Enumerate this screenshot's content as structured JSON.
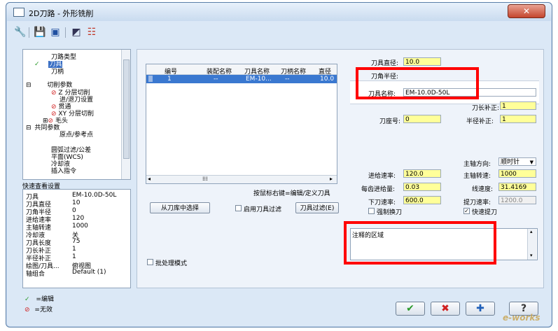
{
  "window": {
    "title": "2D刀路 - 外形铣削"
  },
  "toolbar": {
    "icons": [
      "tool-icon",
      "save-icon",
      "save-all-icon",
      "view-icon",
      "options-icon"
    ]
  },
  "tree": {
    "items": [
      "刀路类型",
      "刀具",
      "刀柄",
      "切削参数",
      "Z 分层切削",
      "进/退刀设置",
      "贯通",
      "XY 分层切削",
      "毛头",
      "共同参数",
      "原点/参考点",
      "圆弧过滤/公差",
      "平面(WCS)",
      "冷却液",
      "插入指令"
    ]
  },
  "quick_view": {
    "title": "快速查看设置",
    "rows": [
      {
        "k": "刀具",
        "v": "EM-10.0D-50L"
      },
      {
        "k": "刀具直径",
        "v": "10"
      },
      {
        "k": "刀角半径",
        "v": "0"
      },
      {
        "k": "进给速率",
        "v": "120"
      },
      {
        "k": "主轴转速",
        "v": "1000"
      },
      {
        "k": "冷却液",
        "v": "关"
      },
      {
        "k": "刀具长度",
        "v": "75"
      },
      {
        "k": "刀长补正",
        "v": "1"
      },
      {
        "k": "半径补正",
        "v": "1"
      },
      {
        "k": "绘图/刀具...",
        "v": "俯视图"
      },
      {
        "k": "轴组合",
        "v": "Default (1)"
      }
    ]
  },
  "legend": {
    "edit": "=编辑",
    "disabled": "=无效"
  },
  "tool_table": {
    "headers": [
      "编号",
      "装配名称",
      "刀具名称",
      "刀柄名称",
      "直径"
    ],
    "row": [
      "1",
      "--",
      "EM-10...",
      "--",
      "10.0"
    ]
  },
  "hint_text": "按鼠标右键=编辑/定义刀具",
  "buttons": {
    "select_from_library": "从刀库中选择",
    "enable_filter": "启用刀具过滤",
    "tool_filter": "刀具过滤(E)",
    "batch_mode": "批处理模式"
  },
  "tool_params": {
    "diameter_label": "刀具直径:",
    "diameter": "10.0",
    "corner_label": "刀角半径:",
    "name_label": "刀具名称:",
    "name": "EM-10.0D-50L",
    "length_comp_label": "刀长补正:",
    "length_comp": "1",
    "seat_label": "刀座号:",
    "seat": "0",
    "radius_comp_label": "半径补正:",
    "radius_comp": "1",
    "spindle_dir_label": "主轴方向:",
    "spindle_dir": "顺时针",
    "feed_label": "进给速率:",
    "feed": "120.0",
    "spindle_speed_label": "主轴转速:",
    "spindle_speed": "1000",
    "feed_per_tooth_label": "每齿进给量:",
    "feed_per_tooth": "0.03",
    "surface_speed_label": "线速度:",
    "surface_speed": "31.4169",
    "plunge_label": "下刀速率:",
    "plunge": "600.0",
    "retract_label": "提刀速率:",
    "retract": "1200.0",
    "force_tool_change": "强制换刀",
    "rapid_retract": "快速提刀"
  },
  "comment": {
    "text": "注释的区域"
  },
  "watermark": "e-works"
}
